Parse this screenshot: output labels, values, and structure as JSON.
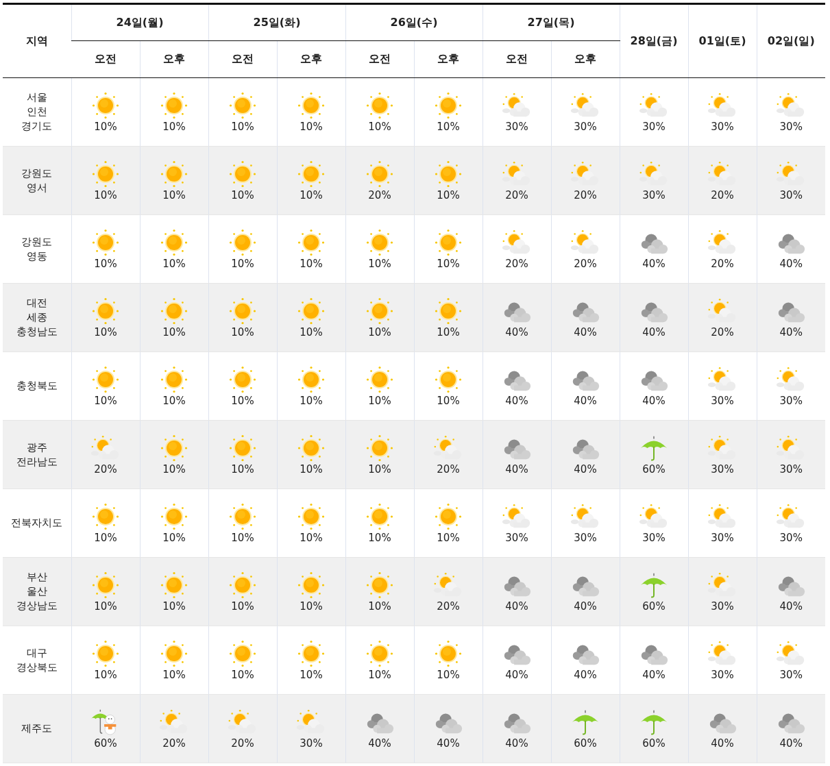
{
  "header": {
    "region_label": "지역",
    "days": [
      {
        "label": "24일(월)",
        "periods": [
          "오전",
          "오후"
        ]
      },
      {
        "label": "25일(화)",
        "periods": [
          "오전",
          "오후"
        ]
      },
      {
        "label": "26일(수)",
        "periods": [
          "오전",
          "오후"
        ]
      },
      {
        "label": "27일(목)",
        "periods": [
          "오전",
          "오후"
        ]
      },
      {
        "label": "28일(금)"
      },
      {
        "label": "01일(토)"
      },
      {
        "label": "02일(일)"
      }
    ]
  },
  "rows": [
    {
      "region_lines": [
        "서울",
        "인천",
        "경기도"
      ],
      "cells": [
        {
          "kind": "sun",
          "chance": "10%"
        },
        {
          "kind": "sun",
          "chance": "10%"
        },
        {
          "kind": "sun",
          "chance": "10%"
        },
        {
          "kind": "sun",
          "chance": "10%"
        },
        {
          "kind": "sun",
          "chance": "10%"
        },
        {
          "kind": "sun",
          "chance": "10%"
        },
        {
          "kind": "partly",
          "chance": "30%"
        },
        {
          "kind": "partly",
          "chance": "30%"
        },
        {
          "kind": "partly",
          "chance": "30%"
        },
        {
          "kind": "partly",
          "chance": "30%"
        },
        {
          "kind": "partly",
          "chance": "30%"
        }
      ]
    },
    {
      "region_lines": [
        "강원도",
        "영서"
      ],
      "cells": [
        {
          "kind": "sun",
          "chance": "10%"
        },
        {
          "kind": "sun",
          "chance": "10%"
        },
        {
          "kind": "sun",
          "chance": "10%"
        },
        {
          "kind": "sun",
          "chance": "10%"
        },
        {
          "kind": "sun",
          "chance": "20%"
        },
        {
          "kind": "sun",
          "chance": "10%"
        },
        {
          "kind": "partly",
          "chance": "20%"
        },
        {
          "kind": "partly",
          "chance": "20%"
        },
        {
          "kind": "partly",
          "chance": "30%"
        },
        {
          "kind": "partly",
          "chance": "20%"
        },
        {
          "kind": "partly",
          "chance": "30%"
        }
      ]
    },
    {
      "region_lines": [
        "강원도",
        "영동"
      ],
      "cells": [
        {
          "kind": "sun",
          "chance": "10%"
        },
        {
          "kind": "sun",
          "chance": "10%"
        },
        {
          "kind": "sun",
          "chance": "10%"
        },
        {
          "kind": "sun",
          "chance": "10%"
        },
        {
          "kind": "sun",
          "chance": "10%"
        },
        {
          "kind": "sun",
          "chance": "10%"
        },
        {
          "kind": "partly",
          "chance": "20%"
        },
        {
          "kind": "partly",
          "chance": "20%"
        },
        {
          "kind": "cloudy",
          "chance": "40%"
        },
        {
          "kind": "partly",
          "chance": "20%"
        },
        {
          "kind": "cloudy",
          "chance": "40%"
        }
      ]
    },
    {
      "region_lines": [
        "대전",
        "세종",
        "충청남도"
      ],
      "cells": [
        {
          "kind": "sun",
          "chance": "10%"
        },
        {
          "kind": "sun",
          "chance": "10%"
        },
        {
          "kind": "sun",
          "chance": "10%"
        },
        {
          "kind": "sun",
          "chance": "10%"
        },
        {
          "kind": "sun",
          "chance": "10%"
        },
        {
          "kind": "sun",
          "chance": "10%"
        },
        {
          "kind": "cloudy",
          "chance": "40%"
        },
        {
          "kind": "cloudy",
          "chance": "40%"
        },
        {
          "kind": "cloudy",
          "chance": "40%"
        },
        {
          "kind": "partly",
          "chance": "20%"
        },
        {
          "kind": "cloudy",
          "chance": "40%"
        }
      ]
    },
    {
      "region_lines": [
        "충청북도"
      ],
      "cells": [
        {
          "kind": "sun",
          "chance": "10%"
        },
        {
          "kind": "sun",
          "chance": "10%"
        },
        {
          "kind": "sun",
          "chance": "10%"
        },
        {
          "kind": "sun",
          "chance": "10%"
        },
        {
          "kind": "sun",
          "chance": "10%"
        },
        {
          "kind": "sun",
          "chance": "10%"
        },
        {
          "kind": "cloudy",
          "chance": "40%"
        },
        {
          "kind": "cloudy",
          "chance": "40%"
        },
        {
          "kind": "cloudy",
          "chance": "40%"
        },
        {
          "kind": "partly",
          "chance": "30%"
        },
        {
          "kind": "partly",
          "chance": "30%"
        }
      ]
    },
    {
      "region_lines": [
        "광주",
        "전라남도"
      ],
      "cells": [
        {
          "kind": "partly",
          "chance": "20%"
        },
        {
          "kind": "sun",
          "chance": "10%"
        },
        {
          "kind": "sun",
          "chance": "10%"
        },
        {
          "kind": "sun",
          "chance": "10%"
        },
        {
          "kind": "sun",
          "chance": "10%"
        },
        {
          "kind": "partly",
          "chance": "20%"
        },
        {
          "kind": "cloudy",
          "chance": "40%"
        },
        {
          "kind": "cloudy",
          "chance": "40%"
        },
        {
          "kind": "rain",
          "chance": "60%"
        },
        {
          "kind": "partly",
          "chance": "30%"
        },
        {
          "kind": "partly",
          "chance": "30%"
        }
      ]
    },
    {
      "region_lines": [
        "전북자치도"
      ],
      "cells": [
        {
          "kind": "sun",
          "chance": "10%"
        },
        {
          "kind": "sun",
          "chance": "10%"
        },
        {
          "kind": "sun",
          "chance": "10%"
        },
        {
          "kind": "sun",
          "chance": "10%"
        },
        {
          "kind": "sun",
          "chance": "10%"
        },
        {
          "kind": "sun",
          "chance": "10%"
        },
        {
          "kind": "partly",
          "chance": "30%"
        },
        {
          "kind": "partly",
          "chance": "30%"
        },
        {
          "kind": "partly",
          "chance": "30%"
        },
        {
          "kind": "partly",
          "chance": "30%"
        },
        {
          "kind": "partly",
          "chance": "30%"
        }
      ]
    },
    {
      "region_lines": [
        "부산",
        "울산",
        "경상남도"
      ],
      "cells": [
        {
          "kind": "sun",
          "chance": "10%"
        },
        {
          "kind": "sun",
          "chance": "10%"
        },
        {
          "kind": "sun",
          "chance": "10%"
        },
        {
          "kind": "sun",
          "chance": "10%"
        },
        {
          "kind": "sun",
          "chance": "10%"
        },
        {
          "kind": "partly",
          "chance": "20%"
        },
        {
          "kind": "cloudy",
          "chance": "40%"
        },
        {
          "kind": "cloudy",
          "chance": "40%"
        },
        {
          "kind": "rain",
          "chance": "60%"
        },
        {
          "kind": "partly",
          "chance": "30%"
        },
        {
          "kind": "cloudy",
          "chance": "40%"
        }
      ]
    },
    {
      "region_lines": [
        "대구",
        "경상북도"
      ],
      "cells": [
        {
          "kind": "sun",
          "chance": "10%"
        },
        {
          "kind": "sun",
          "chance": "10%"
        },
        {
          "kind": "sun",
          "chance": "10%"
        },
        {
          "kind": "sun",
          "chance": "10%"
        },
        {
          "kind": "sun",
          "chance": "10%"
        },
        {
          "kind": "sun",
          "chance": "10%"
        },
        {
          "kind": "cloudy",
          "chance": "40%"
        },
        {
          "kind": "cloudy",
          "chance": "40%"
        },
        {
          "kind": "cloudy",
          "chance": "40%"
        },
        {
          "kind": "partly",
          "chance": "30%"
        },
        {
          "kind": "partly",
          "chance": "30%"
        }
      ]
    },
    {
      "region_lines": [
        "제주도"
      ],
      "cells": [
        {
          "kind": "rain-snow",
          "chance": "60%"
        },
        {
          "kind": "partly",
          "chance": "20%"
        },
        {
          "kind": "partly",
          "chance": "20%"
        },
        {
          "kind": "partly",
          "chance": "30%"
        },
        {
          "kind": "cloudy",
          "chance": "40%"
        },
        {
          "kind": "cloudy",
          "chance": "40%"
        },
        {
          "kind": "cloudy",
          "chance": "40%"
        },
        {
          "kind": "rain",
          "chance": "60%"
        },
        {
          "kind": "rain",
          "chance": "60%"
        },
        {
          "kind": "cloudy",
          "chance": "40%"
        },
        {
          "kind": "cloudy",
          "chance": "40%"
        }
      ]
    }
  ]
}
